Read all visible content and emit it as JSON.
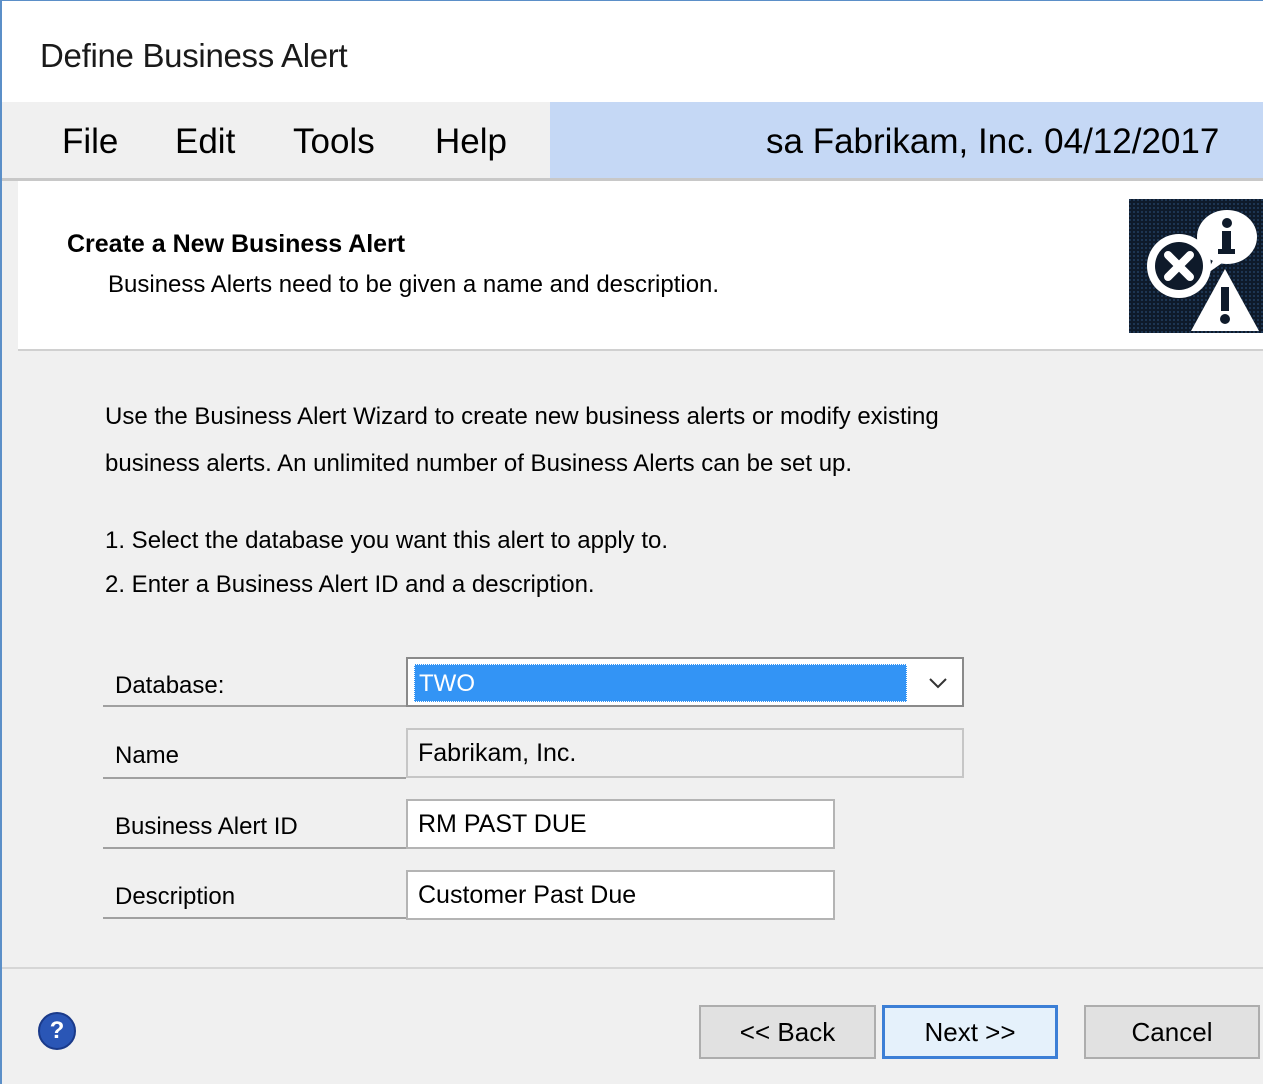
{
  "window": {
    "title": "Define Business Alert"
  },
  "menu": {
    "items": [
      "File",
      "Edit",
      "Tools",
      "Help"
    ],
    "status": "sa  Fabrikam, Inc.  04/12/2017"
  },
  "header": {
    "title": "Create a New Business Alert",
    "subtitle": "Business Alerts need to be given a name and description."
  },
  "intro": {
    "line1": "Use the Business Alert Wizard to create new business alerts or modify existing",
    "line2": "business alerts. An unlimited number of Business Alerts can be set up."
  },
  "steps": {
    "step1": "1. Select the database you want this alert to apply to.",
    "step2": "2. Enter a Business Alert ID and a description."
  },
  "form": {
    "database_label": "Database:",
    "database_value": "TWO",
    "name_label": "Name",
    "name_value": "Fabrikam, Inc.",
    "alert_id_label": "Business Alert ID",
    "alert_id_value": "RM PAST DUE",
    "description_label": "Description",
    "description_value": "Customer Past Due"
  },
  "buttons": {
    "back": "<< Back",
    "next": "Next >>",
    "cancel": "Cancel"
  },
  "icons": {
    "help": "help-icon",
    "wizard_logo": "business-alert-icon",
    "dropdown": "chevron-down-icon"
  },
  "colors": {
    "selection": "#3394f5",
    "status_bar": "#c5d8f5",
    "default_button_border": "#3c7fd6"
  }
}
